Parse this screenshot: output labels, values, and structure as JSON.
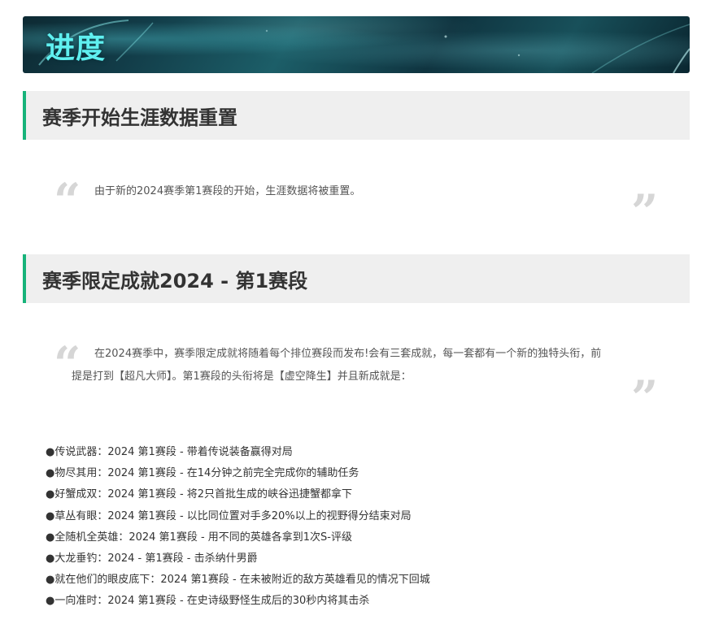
{
  "banner": {
    "title": "进度"
  },
  "section1": {
    "title": "赛季开始生涯数据重置",
    "quote": "由于新的2024赛季第1赛段的开始，生涯数据将被重置。"
  },
  "section2": {
    "title": "赛季限定成就2024 - 第1赛段",
    "quote_line1": "在2024赛季中，赛季限定成就将随着每个排位赛段而发布!会有三套成就，每一套都有一个新的独特头衔，前",
    "quote_line2": "提是打到【超凡大师】。第1赛段的头衔将是【虚空降生】并且新成就是："
  },
  "achievements": [
    "●传说武器：2024 第1赛段 - 带着传说装备赢得对局",
    "●物尽其用：2024 第1赛段 - 在14分钟之前完全完成你的辅助任务",
    "●好蟹成双：2024 第1赛段 - 将2只首批生成的峡谷迅捷蟹都拿下",
    "●草丛有眼：2024 第1赛段 - 以比同位置对手多20%以上的视野得分结束对局",
    "●全随机全英雄：2024 第1赛段 - 用不同的英雄各拿到1次S-评级",
    "●大龙垂钓：2024 - 第1赛段 - 击杀纳什男爵",
    "●就在他们的眼皮底下：2024 第1赛段 - 在未被附近的敌方英雄看见的情况下回城",
    "●一向准时：2024 第1赛段 - 在史诗级野怪生成后的30秒内将其击杀"
  ],
  "quote_marks": {
    "open": "“",
    "close": "”"
  }
}
